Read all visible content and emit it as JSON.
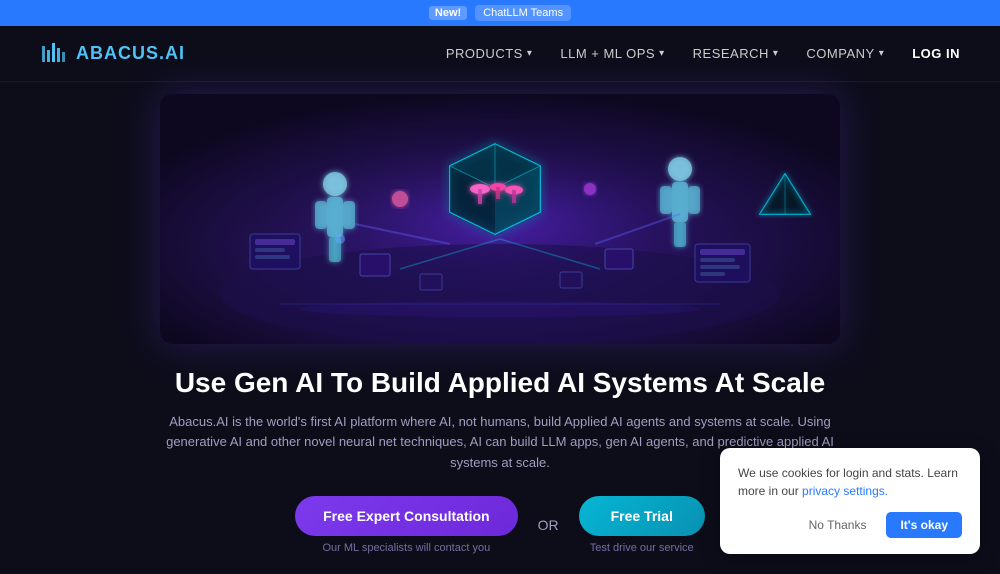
{
  "announcement": {
    "new_label": "New!",
    "link_text": "ChatLLM Teams"
  },
  "nav": {
    "logo_text": "ABACUS",
    "logo_suffix": ".AI",
    "links": [
      {
        "label": "PRODUCTS",
        "has_arrow": true
      },
      {
        "label": "LLM + ML Ops",
        "has_arrow": true
      },
      {
        "label": "RESEARCH",
        "has_arrow": true
      },
      {
        "label": "COMPANY",
        "has_arrow": true
      },
      {
        "label": "LOG IN",
        "has_arrow": false
      }
    ]
  },
  "hero": {
    "headline": "Use Gen AI To Build Applied AI Systems At Scale",
    "subtext": "Abacus.AI is the world's first AI platform where AI, not humans, build Applied AI agents and systems at scale. Using generative AI and other novel neural net techniques, AI can build LLM apps, gen AI agents, and predictive applied AI systems at scale.",
    "cta_primary": "Free Expert Consultation",
    "cta_primary_caption": "Our ML specialists will contact you",
    "or_text": "OR",
    "cta_secondary": "Free Trial",
    "cta_secondary_caption": "Test drive our service"
  },
  "cookie": {
    "text": "We use cookies for login and stats. Learn more in our",
    "link_text": "privacy settings.",
    "btn_decline": "No Thanks",
    "btn_accept": "It's okay"
  }
}
